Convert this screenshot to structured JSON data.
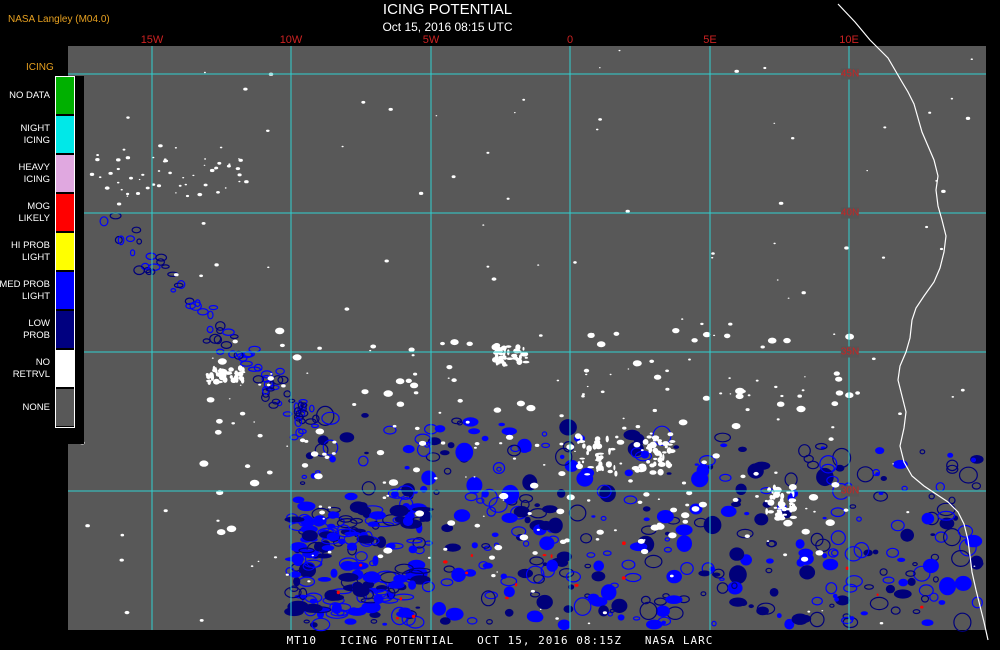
{
  "header": {
    "credit": "NASA Langley (M04.0)",
    "title": "ICING POTENTIAL",
    "timestamp": "Oct 15, 2016 08:15 UTC"
  },
  "map": {
    "lon_labels": [
      "15W",
      "10W",
      "5W",
      "0",
      "5E",
      "10E"
    ],
    "lat_labels": [
      "45N",
      "40N",
      "35N",
      "30N"
    ],
    "colors": {
      "background": "#585858",
      "grid": "#2fd0d0",
      "coastline": "#ffffff",
      "no_retrvl": "#ffffff",
      "med_prob": "#0000ff",
      "low_prob": "#00007a",
      "mog": "#ff0000"
    }
  },
  "legend": {
    "title": "ICING",
    "items": [
      {
        "label_lines": [
          "NO DATA"
        ],
        "color": "#00b000"
      },
      {
        "label_lines": [
          "NIGHT",
          "ICING"
        ],
        "color": "#00e8e8"
      },
      {
        "label_lines": [
          "HEAVY",
          "ICING"
        ],
        "color": "#e0a8e0"
      },
      {
        "label_lines": [
          "MOG",
          "LIKELY"
        ],
        "color": "#ff0000"
      },
      {
        "label_lines": [
          "HI PROB",
          "LIGHT"
        ],
        "color": "#ffff00"
      },
      {
        "label_lines": [
          "MED PROB",
          "LIGHT"
        ],
        "color": "#0000ff"
      },
      {
        "label_lines": [
          "LOW",
          "PROB"
        ],
        "color": "#000080"
      },
      {
        "label_lines": [
          "NO",
          "RETRVL"
        ],
        "color": "#ffffff"
      },
      {
        "label_lines": [
          "NONE"
        ],
        "color": "#585858"
      }
    ]
  },
  "footer": {
    "text": "MT10   ICING POTENTIAL   OCT 15, 2016 08:15Z   NASA LARC"
  }
}
